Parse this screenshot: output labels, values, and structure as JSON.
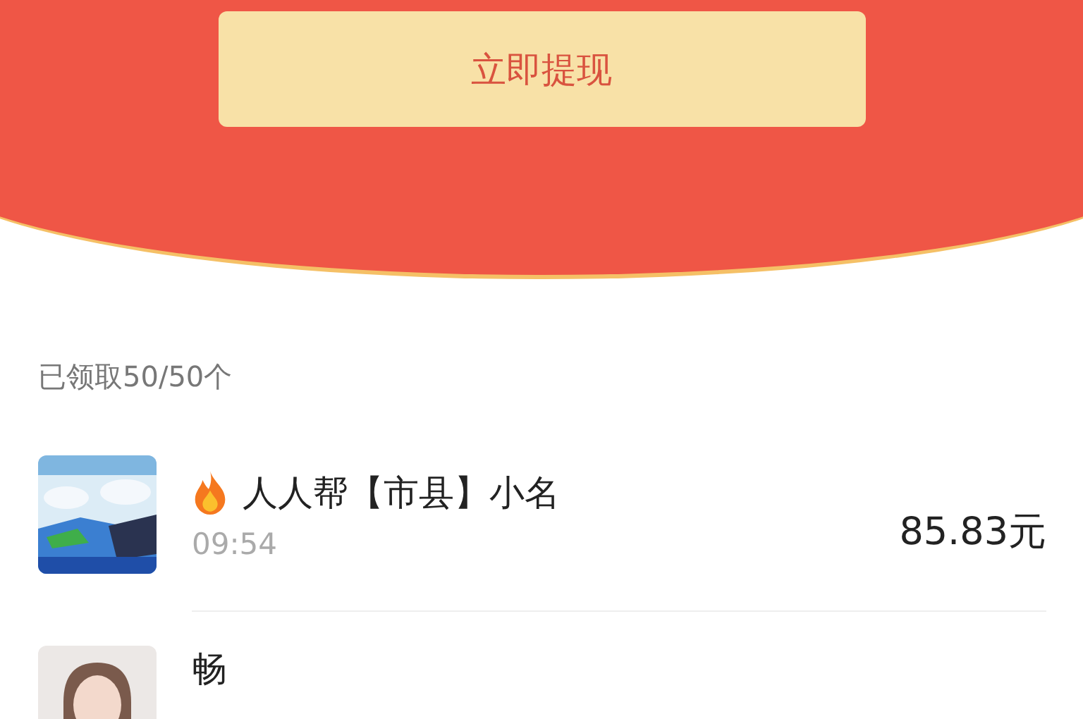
{
  "header": {
    "button": "立即提现"
  },
  "summary": "已领取50/50个",
  "records": [
    {
      "name": "人人帮【市县】小名",
      "hot": true,
      "time": "09:54",
      "amount": "85.83元"
    },
    {
      "name": "畅",
      "hot": false,
      "avatar": {
        "kind": "person"
      }
    }
  ]
}
